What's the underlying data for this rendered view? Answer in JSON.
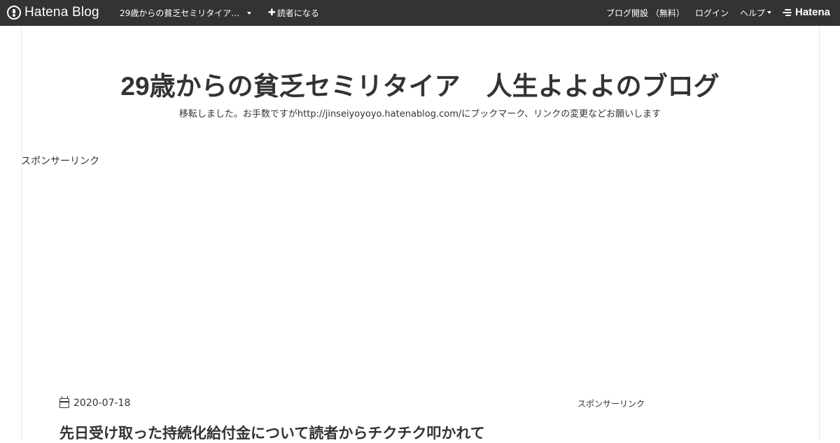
{
  "topbar": {
    "logo_text": "Hatena Blog",
    "blog_title": "29歳からの貧乏セミリタイア　人生よよよのブログ",
    "subscribe_label": "読者になる",
    "create_blog_label": "ブログ開設 （無料）",
    "login_label": "ログイン",
    "help_label": "ヘルプ",
    "brand_label": "Hatena"
  },
  "header": {
    "title": "29歳からの貧乏セミリタイア　人生よよよのブログ",
    "description": "移転しました。お手数ですがhttp://jinseiyoyoyo.hatenablog.com/にブックマーク、リンクの変更などお願いします"
  },
  "ads": {
    "top_label": "スポンサーリンク",
    "side_label": "スポンサーリンク"
  },
  "entry": {
    "date": "2020-07-18",
    "title": "先日受け取った持続化給付金について読者からチクチク叩かれて"
  },
  "colors": {
    "topbar_bg": "#333333",
    "text": "#333333"
  }
}
